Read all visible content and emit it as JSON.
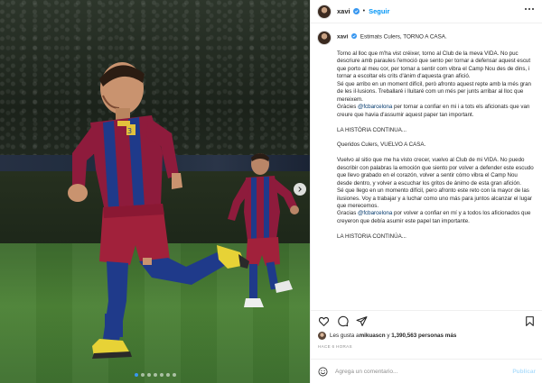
{
  "post": {
    "username": "xavi",
    "separator": "•",
    "follow_label": "Seguir",
    "caption_first_line": "Estimats Culers, TORNO A CASA.",
    "caption_paragraphs": [
      "Torno al lloc que m'ha vist créixer, torno al Club de la meva VIDA. No puc descriure amb paraules l'emoció que sento per tornar a defensar aquest escut que porto al meu cor, per tornar a sentir com vibra el Camp Nou des de dins, i tornar a escoltar els crits d'ànim d'aquesta gran afició.",
      "Sé que arribo en un moment difícil, però afronto aquest repte amb la més gran de les il·lusions. Treballaré i lluitaré com un més per junts arribar al lloc que mereixem."
    ],
    "thanks_ca_before": "Gràcies ",
    "thanks_ca_mention": "@fcbarcelona",
    "thanks_ca_after": " per tornar a confiar en mi i a tots els aficionats que van creure que havia d'assumir aquest paper tan important.",
    "closing_ca": "LA HISTÒRIA CONTINUA...",
    "greeting_es": "Queridos Culers, VUELVO A CASA.",
    "paragraphs_es": [
      "Vuelvo al sitio que me ha visto crecer, vuelvo al Club de mi VIDA. No puedo describir con palabras la emoción que siento por volver a defender este escudo que llevo grabado en el corazón, volver a sentir cómo vibra el Camp Nou desde dentro, y volver a escuchar los gritos de ánimo de esta gran afición.",
      "Sé que llego en un momento difícil, pero afronto este reto con la mayor de las ilusiones. Voy a trabajar y a luchar como uno más para juntos alcanzar el lugar que merecemos."
    ],
    "thanks_es_before": "Gracias ",
    "thanks_es_mention": "@fcbarcelona",
    "thanks_es_after": " por volver a confiar en mí y a todos los aficionados que creyeron que debía asumir este papel tan importante.",
    "closing_es": "LA HISTORIA CONTINÚA...",
    "likes_prefix": "Les gusta a ",
    "likes_user": "mikuascn",
    "likes_middle": " y ",
    "likes_count": "1,390,563 personas más",
    "time_ago": "HACE 6 HORAS",
    "comment_placeholder": "Agrega un comentario...",
    "publish_label": "Publicar"
  },
  "carousel": {
    "total_slides": 7,
    "active_slide": 1
  },
  "colors": {
    "accent": "#0095f6",
    "mention": "#00376b",
    "muted": "#8e8e8e",
    "publish_disabled": "#b2dffc"
  },
  "icons": [
    "verified-badge-icon",
    "more-options-icon",
    "heart-icon",
    "comment-icon",
    "share-icon",
    "save-icon",
    "emoji-icon",
    "chevron-right-icon"
  ]
}
